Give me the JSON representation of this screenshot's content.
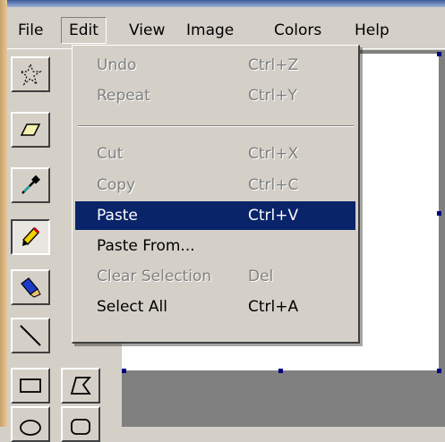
{
  "menubar": {
    "items": [
      {
        "label": "File"
      },
      {
        "label": "Edit"
      },
      {
        "label": "View"
      },
      {
        "label": "Image"
      },
      {
        "label": "Colors"
      },
      {
        "label": "Help"
      }
    ],
    "open_menu": "Edit"
  },
  "edit_menu": {
    "items": [
      {
        "label": "Undo",
        "shortcut": "Ctrl+Z",
        "enabled": false
      },
      {
        "label": "Repeat",
        "shortcut": "Ctrl+Y",
        "enabled": false
      },
      {
        "label": "Cut",
        "shortcut": "Ctrl+X",
        "enabled": false
      },
      {
        "label": "Copy",
        "shortcut": "Ctrl+C",
        "enabled": false
      },
      {
        "label": "Paste",
        "shortcut": "Ctrl+V",
        "enabled": true,
        "highlighted": true
      },
      {
        "label": "Paste From...",
        "shortcut": "",
        "enabled": true
      },
      {
        "label": "Clear Selection",
        "shortcut": "Del",
        "enabled": false
      },
      {
        "label": "Select All",
        "shortcut": "Ctrl+A",
        "enabled": true
      }
    ]
  },
  "toolbox": {
    "tools": [
      {
        "icon": "free-form-select-icon"
      },
      {
        "icon": "eraser-icon"
      },
      {
        "icon": "pick-color-icon"
      },
      {
        "icon": "pencil-icon",
        "selected": true
      },
      {
        "icon": "brush-icon"
      },
      {
        "icon": "line-icon"
      },
      {
        "icon": "rectangle-icon"
      },
      {
        "icon": "polygon-icon"
      },
      {
        "icon": "ellipse-icon"
      },
      {
        "icon": "rounded-rectangle-icon"
      }
    ]
  },
  "colors": {
    "highlight": "#0a246a",
    "face": "#d4d0c8",
    "canvas": "#ffffff",
    "workspace": "#808080"
  }
}
